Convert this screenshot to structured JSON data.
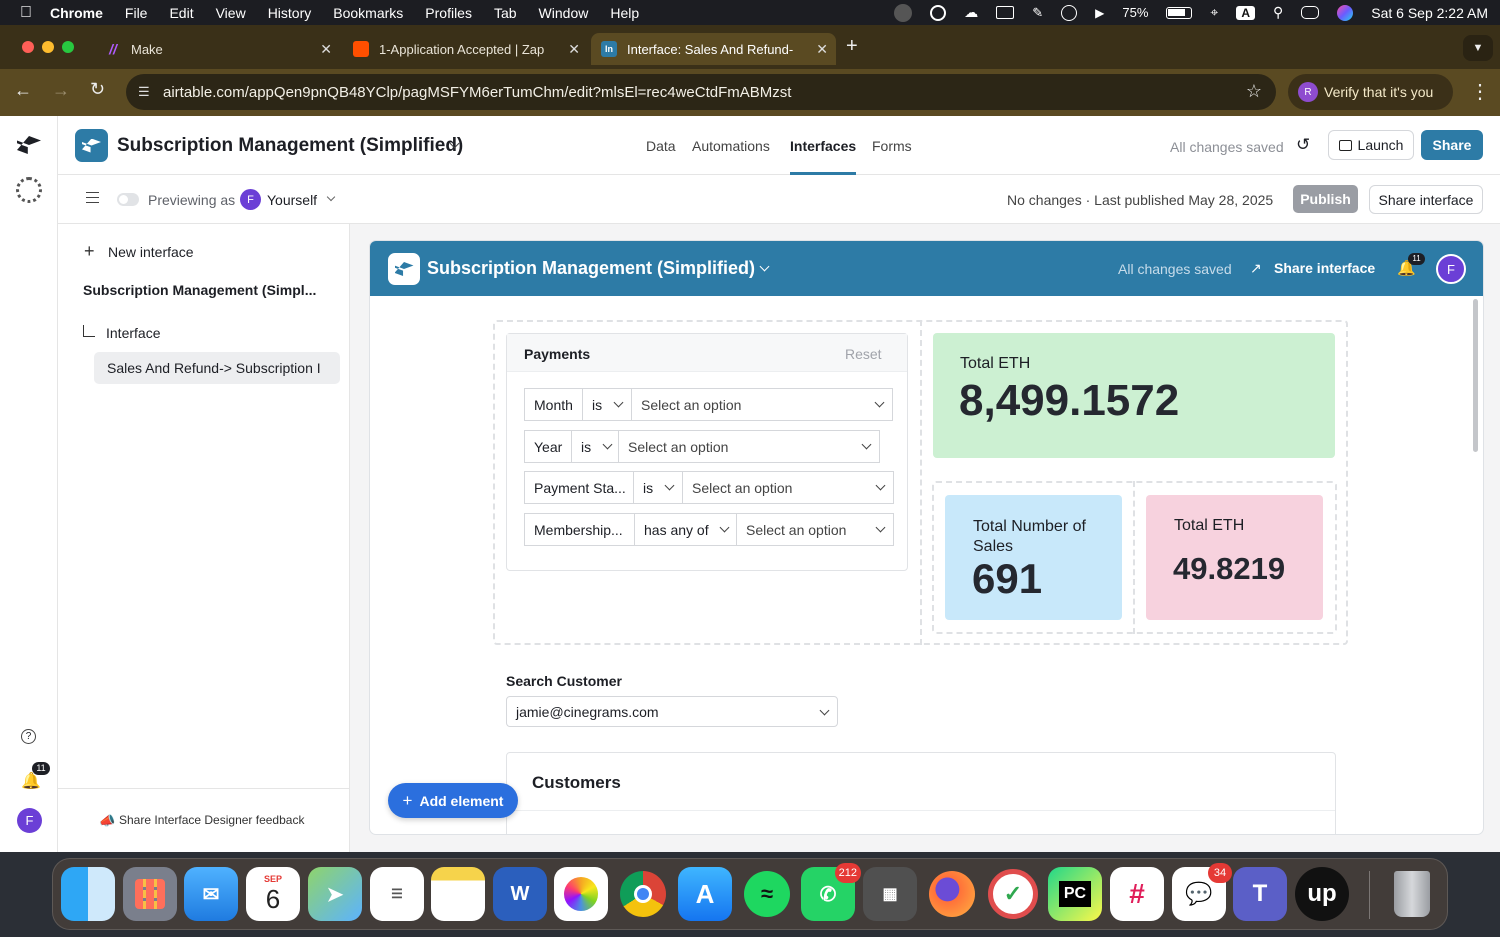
{
  "menubar": {
    "items": [
      "Chrome",
      "File",
      "Edit",
      "View",
      "History",
      "Bookmarks",
      "Profiles",
      "Tab",
      "Window",
      "Help"
    ],
    "battery": "75%",
    "input_indicator": "A",
    "datetime": "Sat 6 Sep  2:22 AM"
  },
  "tabs": [
    {
      "title": "Make",
      "favicon": "make-icon",
      "color": "#6d00cc"
    },
    {
      "title": "1-Application Accepted | Zap",
      "favicon": "zapier-icon",
      "color": "#ff4f00"
    },
    {
      "title": "Interface: Sales And Refund-",
      "favicon": "interface-icon",
      "color": "#2d7ba6",
      "favicon_text": "In"
    }
  ],
  "address_bar": {
    "url": "airtable.com/appQen9pnQB48YClp/pagMSFYM6erTumChm/edit?mlsEl=rec4weCtdFmABMzst",
    "verify_label": "Verify that it's you",
    "verify_avatar": "R"
  },
  "header": {
    "base_title": "Subscription Management (Simplified)",
    "nav": [
      "Data",
      "Automations",
      "Interfaces",
      "Forms"
    ],
    "active_nav": "Interfaces",
    "saved_status": "All changes saved",
    "launch_label": "Launch",
    "share_label": "Share"
  },
  "subheader": {
    "previewing_label": "Previewing as",
    "user_initial": "F",
    "user_name": "Yourself",
    "publish_status": "No changes · Last published May 28, 2025",
    "publish_label": "Publish",
    "share_interface_label": "Share interface"
  },
  "leftnav": {
    "new_interface": "New interface",
    "base_name": "Subscription Management (Simpl...",
    "group": "Interface",
    "page": "Sales And Refund-> Subscription I",
    "feedback": "Share Interface Designer feedback"
  },
  "rail": {
    "notifications_count": "11",
    "avatar_initial": "F"
  },
  "interface": {
    "title": "Subscription Management (Simplified)",
    "saved": "All changes saved",
    "share_label": "Share interface",
    "notif_count": "11",
    "avatar": "F",
    "filters": {
      "title": "Payments",
      "reset": "Reset",
      "rows": [
        {
          "field": "Month",
          "op": "is",
          "value": "Select an option"
        },
        {
          "field": "Year",
          "op": "is",
          "value": "Select an option"
        },
        {
          "field": "Payment Sta...",
          "op": "is",
          "value": "Select an option"
        },
        {
          "field": "Membership...",
          "op": "has any of",
          "value": "Select an option"
        }
      ]
    },
    "metrics": [
      {
        "label": "Total ETH",
        "value": "8,499.1572",
        "color": "#ccf0d2"
      },
      {
        "label": "Total Number of Sales",
        "value": "691",
        "color": "#c8e8fa"
      },
      {
        "label": "Total ETH",
        "value": "49.8219",
        "color": "#f7d2de"
      }
    ],
    "search_label": "Search Customer",
    "search_value": "jamie@cinegrams.com",
    "customers_title": "Customers",
    "add_element": "Add element"
  },
  "dock": {
    "calendar_month": "SEP",
    "calendar_day": "6",
    "whatsapp_badge": "212",
    "messages_badge": "34",
    "pycharm_text": "PC",
    "upwork_text": "up"
  }
}
